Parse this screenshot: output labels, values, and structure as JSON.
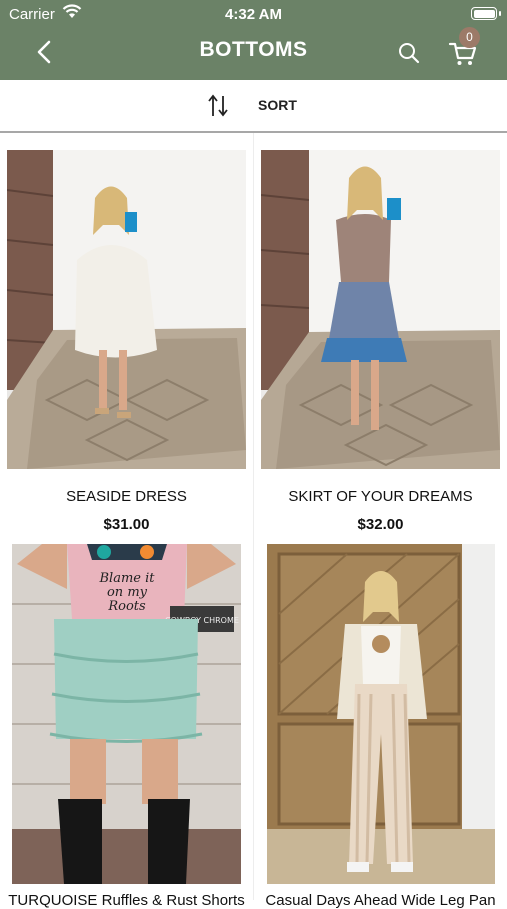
{
  "status_bar": {
    "carrier": "Carrier",
    "time": "4:32 AM"
  },
  "nav": {
    "title": "BOTTOMS",
    "cart_count": "0",
    "icons": [
      "chevron-left-icon",
      "search-icon",
      "cart-icon"
    ],
    "background": "#6b8267",
    "badge_color": "#9c7a68"
  },
  "sort": {
    "label": "SORT",
    "icon": "sort-arrows-icon"
  },
  "products": [
    {
      "name": "SEASIDE DRESS",
      "price": "$31.00"
    },
    {
      "name": "SKIRT OF YOUR DREAMS",
      "price": "$32.00"
    },
    {
      "name": "TURQUOISE Ruffles & Rust Shorts",
      "price": ""
    },
    {
      "name": "Casual Days Ahead Wide Leg Pan",
      "price": ""
    }
  ],
  "photo_text": {
    "tshirt_print": "Blame it on my Roots",
    "sign": "COWBOY CHROME"
  }
}
